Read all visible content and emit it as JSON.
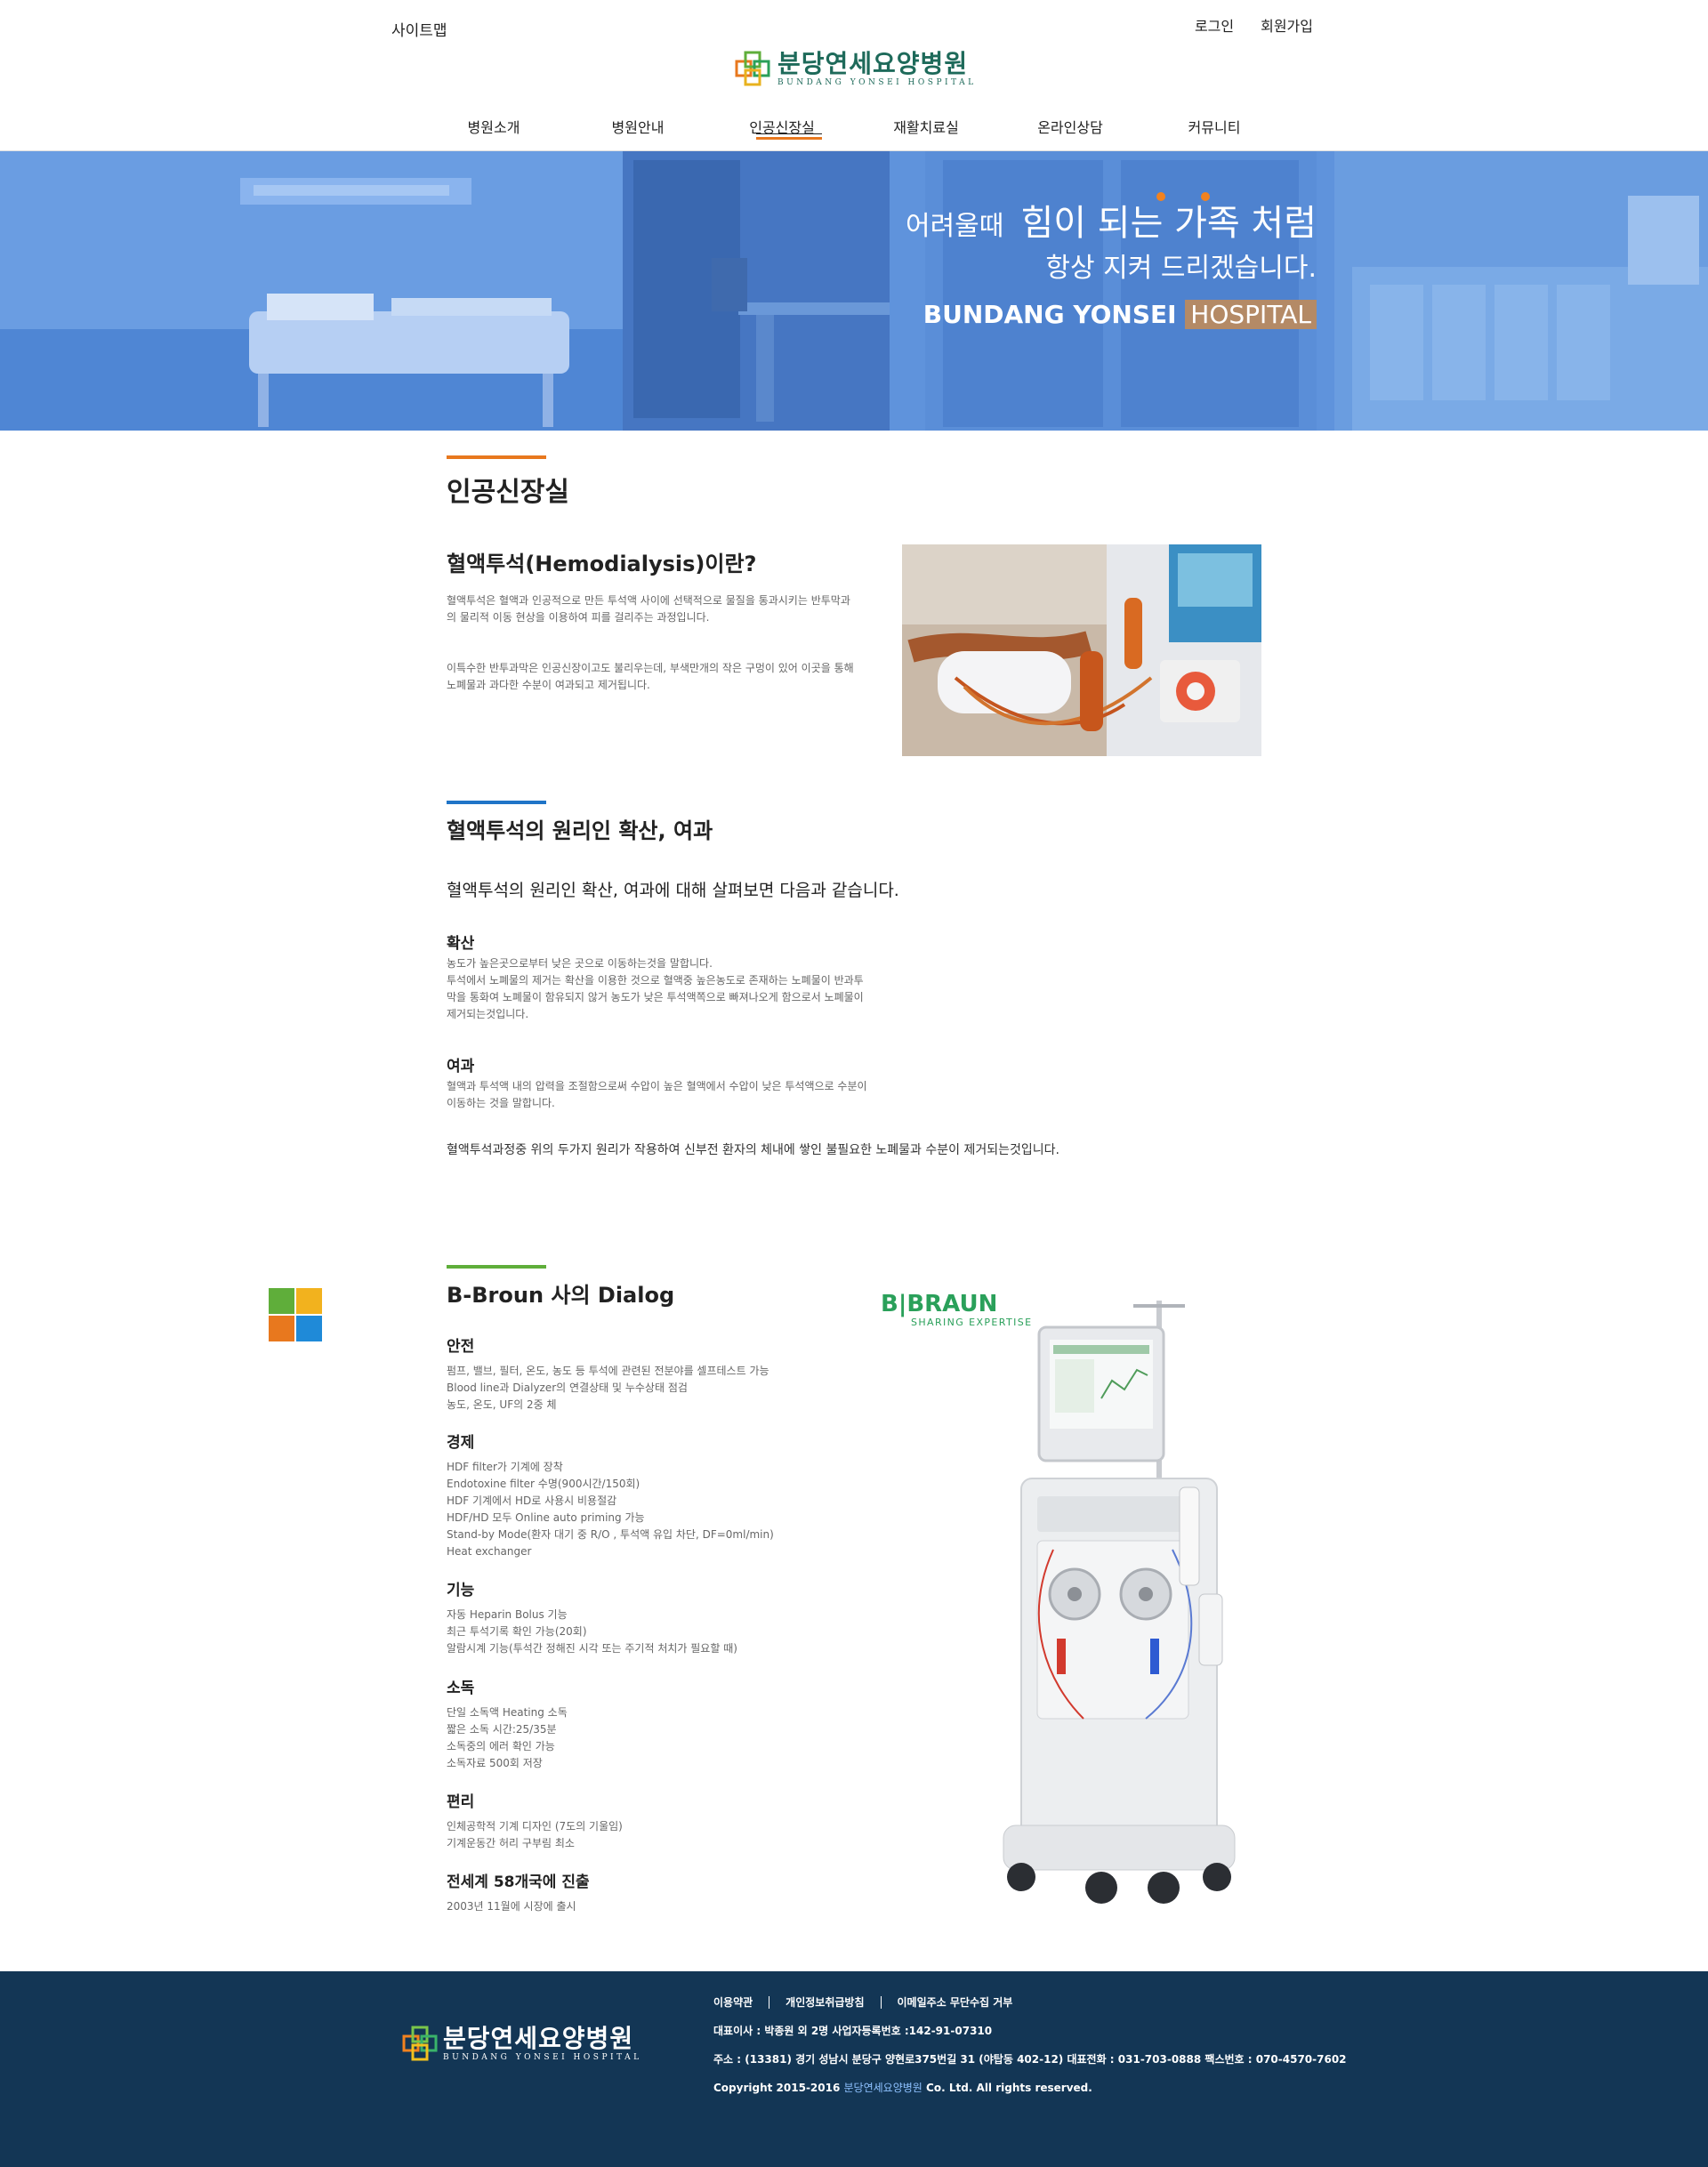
{
  "header": {
    "sitemap": "사이트맵",
    "login": "로그인",
    "join": "회원가입",
    "logo_ko": "분당연세요양병원",
    "logo_en": "BUNDANG YONSEI HOSPITAL",
    "nav": [
      "병원소개",
      "병원안내",
      "인공신장실",
      "재활치료실",
      "온라인상담",
      "커뮤니티"
    ],
    "active_nav": "인공신장실"
  },
  "hero": {
    "line1_small": "어려울때",
    "line1_big": "힘이 되는 가족 처럼",
    "line2": "항상 지켜 드리겠습니다.",
    "line3_bold": "BUNDANG YONSEI",
    "line3_highlight": "HOSPITAL"
  },
  "page": {
    "title": "인공신장실",
    "hd_title": "혈액투석(Hemodialysis)이란?",
    "hd_p1": "혈액투석은 혈액과 인공적으로 만든 투석액 사이에 선택적으로 물질을 통과시키는 반투막과의 물리적 이동 현상을 이용하여 피를 걸리주는 과정입니다.",
    "hd_p2": "이특수한 반투과막은 인공신장이고도 불리우는데, 부색만개의 작은 구멍이 있어 이곳을 통해 노폐물과 과다한 수분이 여과되고 제거됩니다.",
    "principle_title": "혈액투석의 원리인 확산, 여과",
    "principle_lead": "혈액투석의 원리인 확산, 여과에 대해 살펴보면 다음과 같습니다.",
    "diffusion_title": "확산",
    "diffusion_lines": [
      "농도가 높은곳으로부터 낮은 곳으로 이동하는것을 말합니다.",
      "투석에서 노폐물의 제거는 확산을 이용한 것으로 혈액중 높은농도로 존재하는 노폐물이 반과투",
      "막을 통화여 노폐물이 함유되지 않거 농도가 낮은 투석액쪽으로 빠져나오게 함으로서 노폐물이",
      "제거되는것입니다."
    ],
    "filtration_title": "여과",
    "filtration_lines": [
      "혈액과 투석액 내의 압력을 조절함으로써 수압이 높은 혈액에서 수압이 낮은 투석액으로 수분이",
      "이동하는 것을 말합니다."
    ],
    "summary": "혈액투석과정중 위의 두가지 원리가 작용하여 신부전 환자의 체내에 쌓인 불필요한 노폐물과 수분이 제거되는것입니다.",
    "dialog_title": "B-Broun 사의 Dialog",
    "features": [
      {
        "title": "안전",
        "lines": [
          "펌프, 밸브, 필터, 온도, 농도 등 투석에 관련된 전분야를 셀프테스트 가능",
          "Blood line과 Dialyzer의 연결상태 및 누수상태 점검",
          "농도, 온도, UF의 2중 체"
        ]
      },
      {
        "title": "경제",
        "lines": [
          "HDF filter가 기계에 장착",
          "Endotoxine filter 수명(900시간/150회)",
          "HDF 기계에서 HD로 사용시 비용절감",
          "HDF/HD 모두 Online auto priming 가능",
          "Stand-by Mode(환자 대기 중 R/O , 투석액 유입 차단, DF=0ml/min)",
          "Heat exchanger"
        ]
      },
      {
        "title": "기능",
        "lines": [
          "자동 Heparin Bolus 기능",
          "최근 투석기록 확인 가능(20회)",
          "알람시계 기능(투석간 정해진 시각 또는 주기적 처치가 필요할 때)"
        ]
      },
      {
        "title": "소독",
        "lines": [
          "단일 소독액 Heating 소독",
          "짧은 소독 시간:25/35분",
          "소독중의 에러 확인 가능",
          "소독자료 500회 저장"
        ]
      },
      {
        "title": "편리",
        "lines": [
          "인체공학적 기계 디자인 (7도의 기울임)",
          "기계운동간 허리 구부림 최소"
        ]
      },
      {
        "title": "전세계 58개국에 진출",
        "lines": [
          "2003년 11월에 시장에 출시"
        ]
      }
    ],
    "braun_logo": "B|BRAUN",
    "braun_tag": "SHARING EXPERTISE"
  },
  "footer": {
    "links": [
      "이용약관",
      "개인정보취급방침",
      "이메일주소 무단수집 거부"
    ],
    "rep": "대표이사 : 박종원 외 2명 사업자등록번호 :142-91-07310",
    "address": "주소 : (13381) 경기 성남시 분당구 양현로375번길 31 (야탑동 402-12) 대표전화 : 031-703-0888 팩스번호 : 070-4570-7602",
    "copyright_pre": "Copyright 2015-2016",
    "copyright_brand": "분당연세요양병원",
    "copyright_post": "Co. Ltd. All rights reserved."
  },
  "colors": {
    "accent_orange": "#e8781e",
    "accent_blue": "#1f74c7",
    "accent_green": "#5fae3a",
    "footer_bg": "#133655",
    "logo_green": "#1e6a5a",
    "braun_green": "#2aa05a"
  }
}
